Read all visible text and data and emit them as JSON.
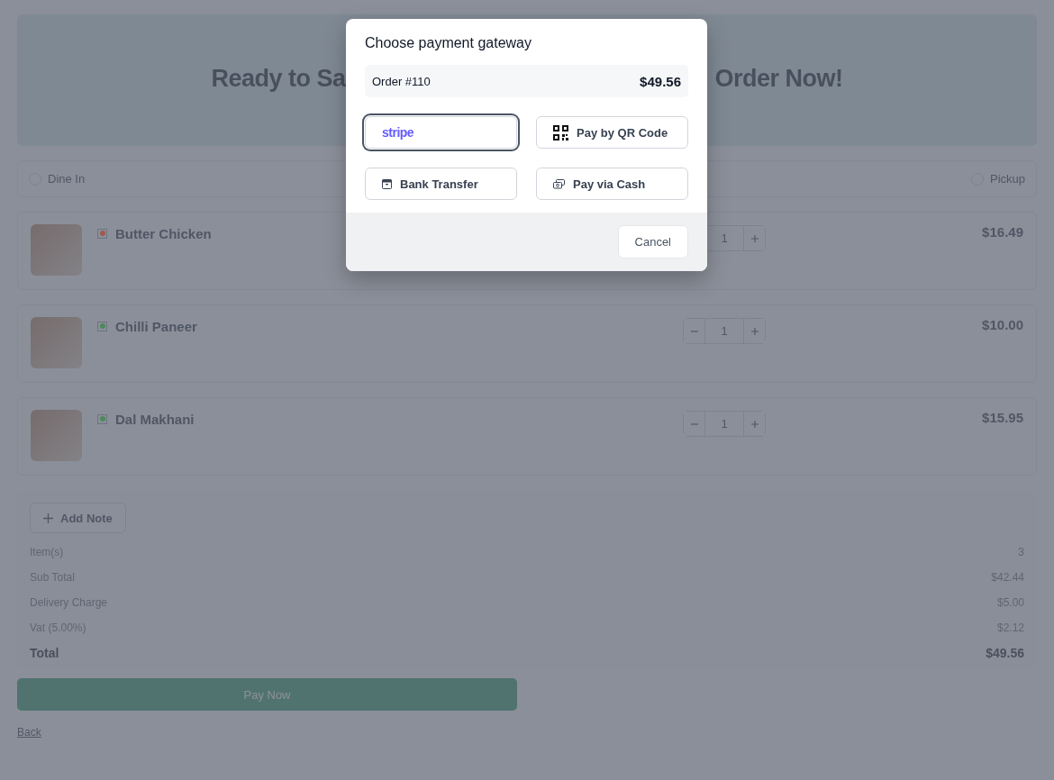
{
  "banner": {
    "heading_left": "Ready to Sa",
    "heading_right": "Order Now!"
  },
  "order_types": [
    {
      "label": "Dine In",
      "selected": false
    },
    {
      "label": "Pickup",
      "selected": false
    }
  ],
  "items": [
    {
      "name": "Butter Chicken",
      "color": "#a05a52",
      "quantity": "1",
      "price": "$16.49"
    },
    {
      "name": "Chilli Paneer",
      "color": "#4d8a5a",
      "quantity": "1",
      "price": "$10.00"
    },
    {
      "name": "Dal Makhani",
      "color": "#4d8a5a",
      "quantity": "1",
      "price": "$15.95"
    }
  ],
  "summary": {
    "add_note": "Add Note",
    "rows": [
      {
        "label": "Item(s)",
        "value": "3"
      },
      {
        "label": "Sub Total",
        "value": "$42.44"
      },
      {
        "label": "Delivery Charge",
        "value": "$5.00"
      },
      {
        "label": "Vat (5.00%)",
        "value": "$2.12"
      }
    ],
    "total_label": "Total",
    "total_value": "$49.56"
  },
  "pay_now": "Pay Now",
  "back": "Back",
  "modal": {
    "title": "Choose payment gateway",
    "order": "Order #110",
    "amount": "$49.56",
    "options": [
      {
        "kind": "stripe",
        "label": "stripe",
        "selected": true
      },
      {
        "kind": "qr",
        "label": "Pay by QR Code",
        "selected": false
      },
      {
        "kind": "bank",
        "label": "Bank Transfer",
        "selected": false
      },
      {
        "kind": "cash",
        "label": "Pay via Cash",
        "selected": false
      }
    ],
    "cancel": "Cancel"
  }
}
